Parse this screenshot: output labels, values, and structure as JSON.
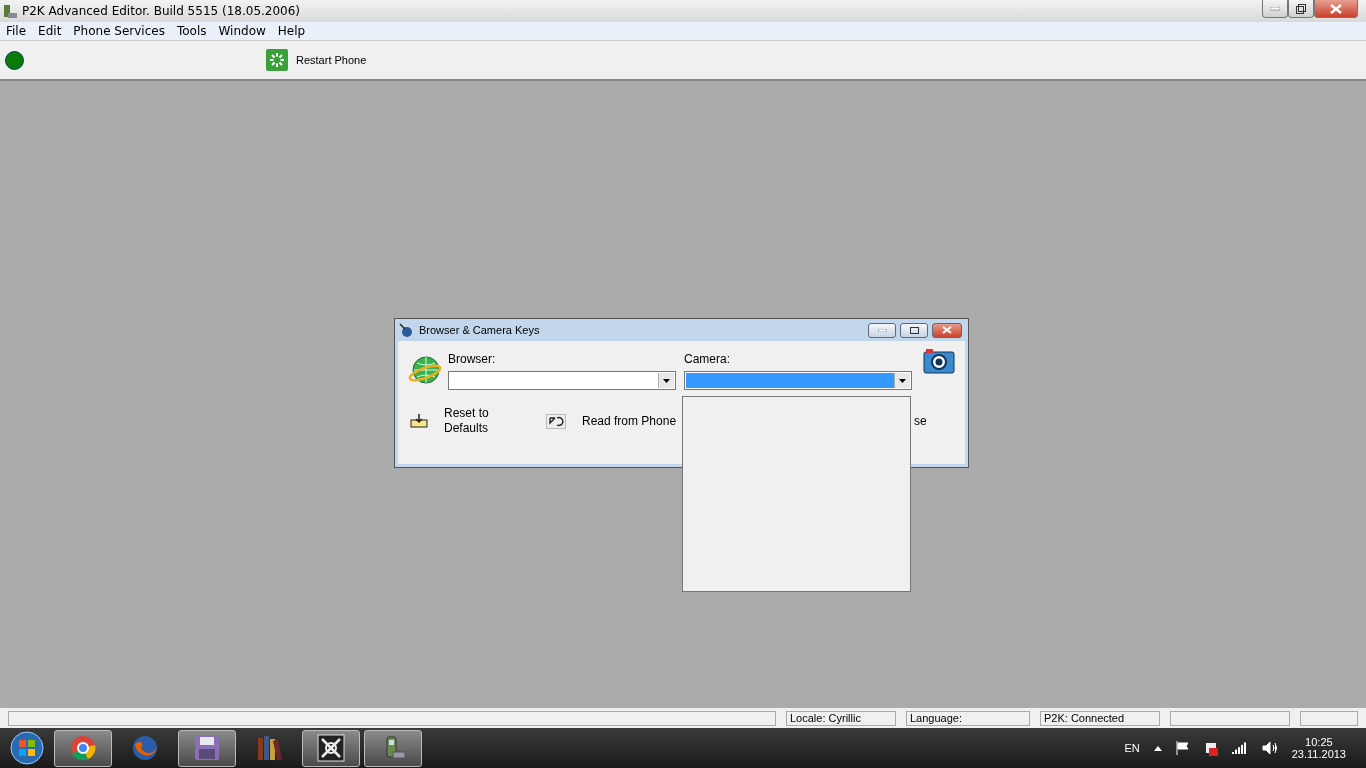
{
  "window": {
    "title": "P2K Advanced Editor. Build 5515 (18.05.2006)"
  },
  "menu": [
    "File",
    "Edit",
    "Phone Services",
    "Tools",
    "Window",
    "Help"
  ],
  "toolbar": {
    "connected": true,
    "button": "Restart Phone"
  },
  "dialog": {
    "title": "Browser & Camera Keys",
    "browser": {
      "label": "Browser:",
      "value_selected": false
    },
    "camera": {
      "label": "Camera:",
      "value_selected": true,
      "expanded": true
    },
    "buttons": [
      {
        "kind": "reset",
        "label": "Reset to",
        "label2": "Defaults"
      },
      {
        "kind": "read",
        "label": "Read from Phone"
      },
      {
        "kind": "close",
        "label": "se"
      }
    ]
  },
  "status_bar": [
    "Locale: Cyrillic",
    "Language:",
    "P2K: Connected"
  ],
  "taskbar": {
    "apps": [
      {
        "kind": "chrome",
        "running": true
      },
      {
        "kind": "firefox",
        "running": false
      },
      {
        "kind": "floppy",
        "running": true
      },
      {
        "kind": "books",
        "running": false
      },
      {
        "kind": "tool",
        "running": true
      },
      {
        "kind": "phone",
        "running": true
      }
    ],
    "language": "EN",
    "time": "10:25",
    "date": "23.11.2013"
  }
}
